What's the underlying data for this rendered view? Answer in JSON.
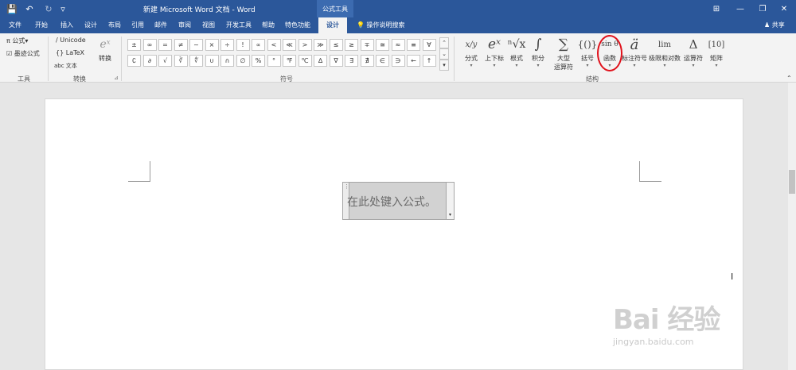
{
  "titlebar": {
    "title": "新建 Microsoft Word 文档 - Word",
    "context_tab": "公式工具",
    "save": "💾",
    "undo": "↶",
    "redo": "↻",
    "customize": "▿",
    "ribbon_opts": "⊞",
    "minimize": "—",
    "restore": "❐",
    "close": "✕"
  },
  "tabs": [
    "文件",
    "开始",
    "插入",
    "设计",
    "布局",
    "引用",
    "邮件",
    "审阅",
    "视图",
    "开发工具",
    "帮助",
    "特色功能",
    "设计"
  ],
  "tellme": "操作说明搜索",
  "share": "♟ 共享",
  "tools": {
    "equation": "π 公式",
    "equation_dd": "▾",
    "ink": "☑ 墨迹公式",
    "label": "工具"
  },
  "convert": {
    "unicode": "Unicode",
    "latex": "LaTeX",
    "text": "abc 文本",
    "convert": "转换",
    "convert_icon": "eˣ",
    "label": "转换",
    "launcher": "⊿"
  },
  "symbols": {
    "row1": [
      "±",
      "∞",
      "=",
      "≠",
      "~",
      "×",
      "÷",
      "!",
      "∝",
      "<",
      "≪",
      ">",
      "≫",
      "≤",
      "≥",
      "∓",
      "≅",
      "≈",
      "≡",
      "∀"
    ],
    "row2": [
      "∁",
      "∂",
      "√",
      "∛",
      "∜",
      "∪",
      "∩",
      "∅",
      "%",
      "°",
      "℉",
      "℃",
      "∆",
      "∇",
      "∃",
      "∄",
      "∈",
      "∋",
      "←",
      "↑"
    ],
    "scroll_up": "⌃",
    "scroll_down": "⌄",
    "more": "▾",
    "label": "符号"
  },
  "structures": {
    "label": "结构",
    "items": [
      {
        "icon": "x/y",
        "label": "分式",
        "dd": "▾"
      },
      {
        "icon": "eˣ",
        "label": "上下标",
        "dd": "▾"
      },
      {
        "icon": "ⁿ√x",
        "label": "根式",
        "dd": "▾"
      },
      {
        "icon": "∫",
        "label": "积分",
        "dd": "▾"
      },
      {
        "icon": "∑",
        "label": "大型",
        "label2": "运算符",
        "dd": "▾"
      },
      {
        "icon": "{()}",
        "label": "括号",
        "dd": "▾"
      },
      {
        "icon": "sin θ",
        "label": "函数",
        "dd": "▾"
      },
      {
        "icon": "ä",
        "label": "标注符号",
        "dd": "▾"
      },
      {
        "icon": "lim",
        "label": "极限和对数",
        "dd": "▾"
      },
      {
        "icon": "Δ",
        "label": "运算符",
        "dd": "▾"
      },
      {
        "icon": "[10]",
        "label": "矩阵",
        "dd": "▾"
      }
    ]
  },
  "collapse": "⌃",
  "equation_box": {
    "placeholder": "在此处键入公式。",
    "handle": "⋮",
    "dropdown": "▾"
  },
  "cursor": "I",
  "watermark": {
    "brand": "Bai 经验",
    "url": "jingyan.baidu.com"
  }
}
